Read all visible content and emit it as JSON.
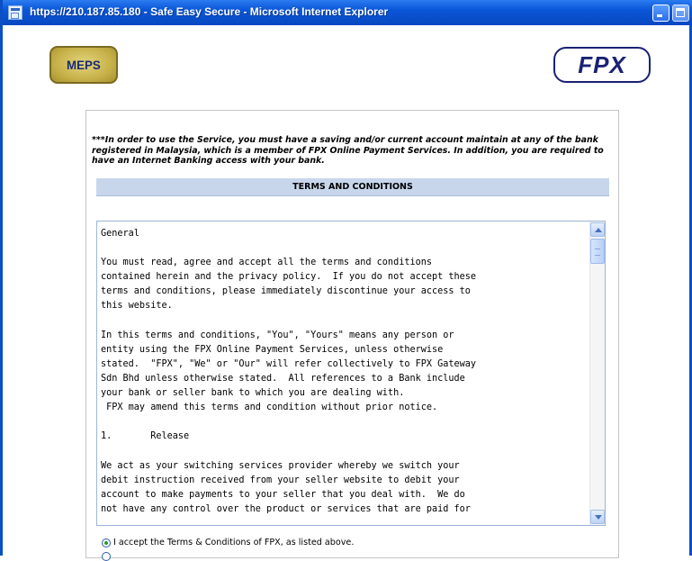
{
  "window": {
    "title": "https://210.187.85.180 - Safe Easy Secure - Microsoft Internet Explorer"
  },
  "logos": {
    "left": "MEPS",
    "right": "FPX"
  },
  "notice": "***In order to use the Service, you must have a saving and/or current account maintain at any of the bank registered in Malaysia, which is a member of FPX Online Payment Services. In addition, you are required to have an Internet Banking access with your bank.",
  "terms": {
    "heading": "TERMS AND CONDITIONS",
    "lines": [
      "General",
      "",
      "You must read, agree and accept all the terms and conditions",
      "contained herein and the privacy policy.  If you do not accept these",
      "terms and conditions, please immediately discontinue your access to",
      "this website.",
      "",
      "In this terms and conditions, \"You\", \"Yours\" means any person or",
      "entity using the FPX Online Payment Services, unless otherwise",
      "stated.  \"FPX\", \"We\" or \"Our\" will refer collectively to FPX Gateway",
      "Sdn Bhd unless otherwise stated.  All references to a Bank include",
      "your bank or seller bank to which you are dealing with.",
      " FPX may amend this terms and condition without prior notice.",
      "",
      "1.       Release",
      "",
      "We act as your switching services provider whereby we switch your",
      "debit instruction received from your seller website to debit your",
      "account to make payments to your seller that you deal with.  We do",
      "not have any control over the product or services that are paid for"
    ]
  },
  "accept": {
    "label": "I accept the Terms & Conditions of FPX, as listed above.",
    "selected": true
  }
}
